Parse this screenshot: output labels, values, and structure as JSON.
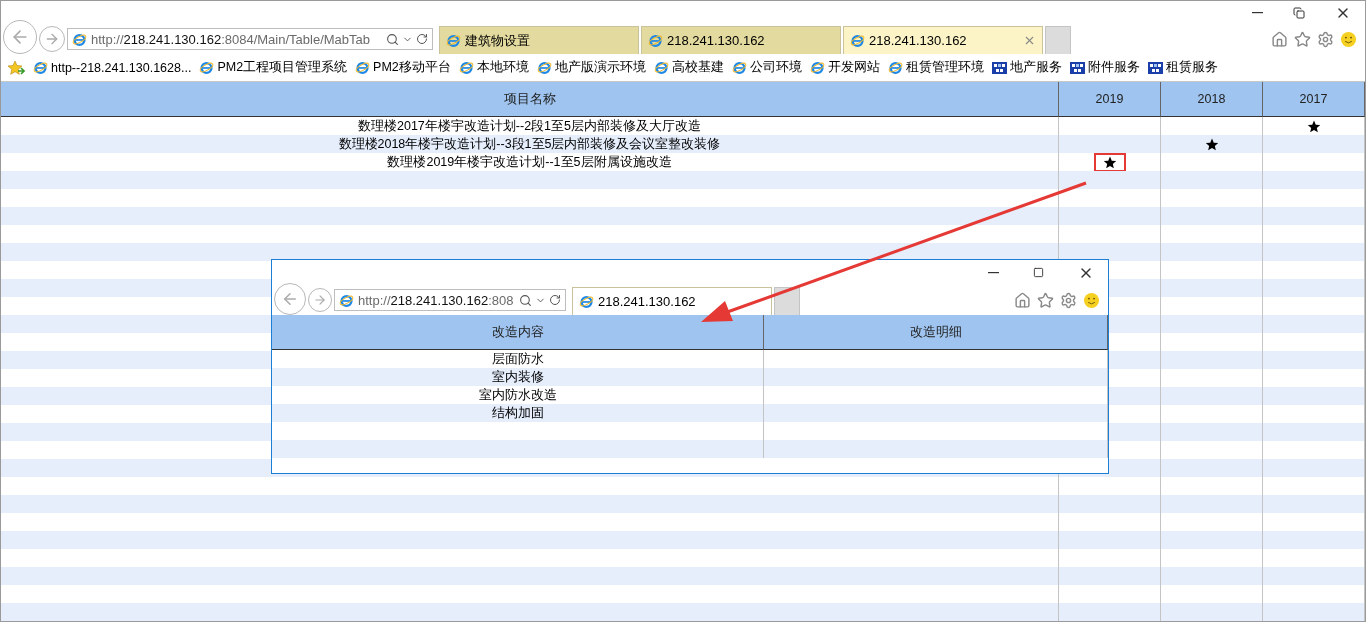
{
  "browser": {
    "address": {
      "scheme": "http://",
      "host": "218.241.130.162",
      "rest": ":8084/Main/Table/MabTab"
    },
    "tabs": [
      {
        "label": "建筑物设置",
        "selected": false
      },
      {
        "label": "218.241.130.162",
        "selected": false
      },
      {
        "label": "218.241.130.162",
        "selected": true
      }
    ],
    "favorites": [
      {
        "label": "http--218.241.130.1628...",
        "kind": "ie"
      },
      {
        "label": "PM2工程项目管理系统",
        "kind": "ie"
      },
      {
        "label": "PM2移动平台",
        "kind": "ie"
      },
      {
        "label": "本地环境",
        "kind": "ie"
      },
      {
        "label": "地产版演示环境",
        "kind": "ie"
      },
      {
        "label": "高校基建",
        "kind": "ie"
      },
      {
        "label": "公司环境",
        "kind": "ie"
      },
      {
        "label": "开发网站",
        "kind": "ie"
      },
      {
        "label": "租赁管理环境",
        "kind": "ie"
      },
      {
        "label": "地产服务",
        "kind": "app"
      },
      {
        "label": "附件服务",
        "kind": "app"
      },
      {
        "label": "租赁服务",
        "kind": "app"
      }
    ]
  },
  "table": {
    "columns": [
      "项目名称",
      "2019",
      "2018",
      "2017"
    ],
    "rows": [
      {
        "name": "数理楼2017年楼宇改造计划--2段1至5层内部装修及大厅改造",
        "cells": [
          {
            "starred": false,
            "highlighted": false
          },
          {
            "starred": false,
            "highlighted": false
          },
          {
            "starred": true,
            "highlighted": false
          }
        ]
      },
      {
        "name": "数理楼2018年楼宇改造计划--3段1至5层内部装修及会议室整改装修",
        "cells": [
          {
            "starred": false,
            "highlighted": false
          },
          {
            "starred": true,
            "highlighted": false
          },
          {
            "starred": false,
            "highlighted": false
          }
        ]
      },
      {
        "name": "数理楼2019年楼宇改造计划--1至5层附属设施改造",
        "cells": [
          {
            "starred": true,
            "highlighted": true
          },
          {
            "starred": false,
            "highlighted": false
          },
          {
            "starred": false,
            "highlighted": false
          }
        ]
      }
    ]
  },
  "popup": {
    "address": {
      "scheme": "http://",
      "host": "218.241.130.162",
      "rest": ":808"
    },
    "tab": {
      "label": "218.241.130.162",
      "selected": true
    },
    "table": {
      "columns": [
        "改造内容",
        "改造明细"
      ],
      "rows": [
        {
          "content": "层面防水"
        },
        {
          "content": "室内装修"
        },
        {
          "content": "室内防水改造"
        },
        {
          "content": "结构加固"
        }
      ]
    }
  }
}
